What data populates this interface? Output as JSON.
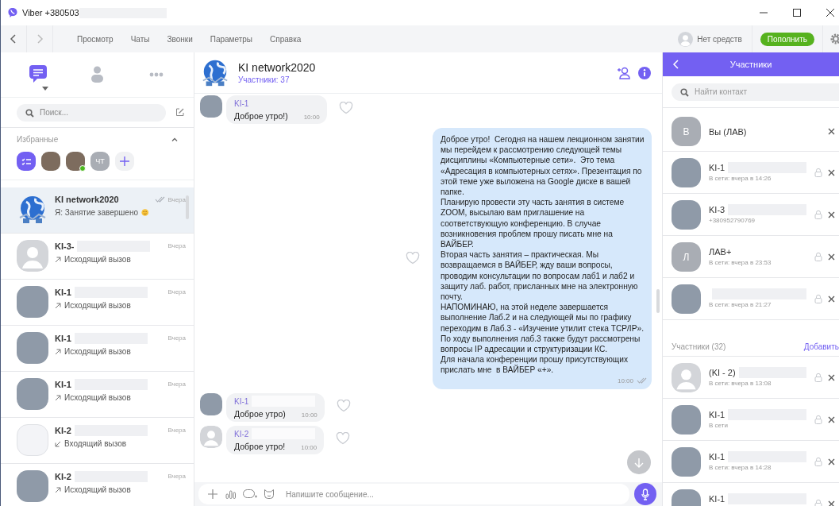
{
  "window": {
    "title": "Viber +380503",
    "title_redacted": true
  },
  "menu": {
    "items": [
      "Просмотр",
      "Чаты",
      "Звонки",
      "Параметры",
      "Справка"
    ],
    "balance": "Нет средств",
    "topup_button": "Пополнить"
  },
  "sidebar": {
    "tabs": [
      {
        "kind": "chats",
        "selected": true
      },
      {
        "kind": "contacts",
        "selected": false
      },
      {
        "kind": "more",
        "selected": false
      }
    ],
    "search": {
      "placeholder": "Поиск..."
    },
    "favorites": {
      "title": "Избранные",
      "expanded": true,
      "items": [
        {
          "kind": "list",
          "online": false
        },
        {
          "kind": "photo",
          "online": false
        },
        {
          "kind": "photo",
          "online": true
        },
        {
          "kind": "letter",
          "text": "ЧТ",
          "online": false
        },
        {
          "kind": "add",
          "online": false
        }
      ]
    },
    "chats": [
      {
        "avatar": {
          "kind": "globe"
        },
        "name": "KI network2020",
        "redacted": false,
        "time": "Вчера",
        "read": true,
        "emoji": true,
        "preview": "Я: Занятие завершено",
        "selected": true
      },
      {
        "avatar": {
          "kind": "default"
        },
        "name": "KI-3-",
        "redacted": true,
        "time": "Вчера",
        "read": false,
        "call": {
          "kind": "outgoing"
        },
        "emoji": false,
        "preview": "Исходящий вызов",
        "selected": false
      },
      {
        "avatar": {
          "kind": "photo"
        },
        "name": "KI-1",
        "redacted": true,
        "time": "Вчера",
        "read": false,
        "call": {
          "kind": "outgoing"
        },
        "emoji": false,
        "preview": "Исходящий вызов",
        "selected": false
      },
      {
        "avatar": {
          "kind": "photo"
        },
        "name": "KI-1",
        "redacted": true,
        "time": "Вчера",
        "read": false,
        "call": {
          "kind": "outgoing"
        },
        "emoji": false,
        "preview": "Исходящий вызов",
        "selected": false
      },
      {
        "avatar": {
          "kind": "photo"
        },
        "name": "KI-1",
        "redacted": true,
        "time": "Вчера",
        "read": false,
        "call": {
          "kind": "outgoing"
        },
        "emoji": false,
        "preview": "Исходящий вызов",
        "selected": false
      },
      {
        "avatar": {
          "kind": "document"
        },
        "name": "KI-2",
        "redacted": true,
        "time": "Вчера",
        "read": false,
        "call": {
          "kind": "incoming"
        },
        "emoji": false,
        "preview": "Входящий вызов",
        "selected": false
      },
      {
        "avatar": {
          "kind": "photo"
        },
        "name": "KI-2",
        "redacted": true,
        "time": "Вчера",
        "read": false,
        "call": {
          "kind": "outgoing"
        },
        "emoji": false,
        "preview": "Исходящий вызов",
        "selected": false
      }
    ]
  },
  "chat": {
    "title": "KI network2020",
    "subtitle": "Участники: 37",
    "messages": [
      {
        "kind": "in",
        "avatar": {
          "kind": "photo"
        },
        "sender": "KI-1",
        "redacted": false,
        "text": "Доброе утро!)",
        "time": "10:00",
        "read": false
      },
      {
        "kind": "out",
        "text": "Доброе утро!  Сегодня на нашем лекционном занятии мы перейдем к рассмотрению следующей темы дисциплины «Компьютерные сети».  Это тема «Адресация в компьютерных сетях». Презентация по этой теме уже выложена на Google диске в вашей папке.\nПланирую провести эту часть занятия в системе ZOOM, высылаю вам приглашение на соответствующую конференцию. В случае возникновения проблем прошу писать мне на ВАЙБЕР.\nВторая часть занятия – практическая. Мы возвращаемся в ВАЙБЕР, жду ваши вопросы, проводим консультации по вопросам лаб1 и лаб2 и защиту лаб. работ, присланных мне на электронную почту.\nНАПОМИНАЮ, на этой неделе завершается выполнение Лаб.2 и на следующей мы по графику переходим в Лаб.3 - «Изучение утилит стека TCP/IP». По ходу выполнения лаб.3 также будут рассмотрены вопросы IP адресации и структуризации КС.\nДля начала конференции прошу присутствующих прислать мне  в ВАЙБЕР «+».",
        "time": "10:00",
        "read": true
      },
      {
        "kind": "in",
        "avatar": {
          "kind": "photo"
        },
        "sender": "KI-1",
        "redacted": true,
        "text": "Доброе утро)",
        "time": "10:00",
        "read": false
      },
      {
        "kind": "in",
        "avatar": {
          "kind": "default"
        },
        "sender": "KI-2",
        "redacted": true,
        "text": "Доброе утро!",
        "time": "10:00",
        "read": false
      }
    ],
    "input": {
      "placeholder": "Напишите сообщение..."
    }
  },
  "members_panel": {
    "title": "Участники",
    "search": {
      "placeholder": "Найти контакт"
    },
    "admins": [
      {
        "avatar": {
          "kind": "letter",
          "text": "В"
        },
        "name": "Вы (ЛАВ)",
        "redacted": false,
        "lock": false
      },
      {
        "avatar": {
          "kind": "photo"
        },
        "name": "KI-1",
        "redacted": true,
        "status": "В сети: вчера в 14:26",
        "lock": true
      },
      {
        "avatar": {
          "kind": "photo"
        },
        "name": "KI-3",
        "redacted": true,
        "status": "+380952790769",
        "lock": true
      },
      {
        "avatar": {
          "kind": "letter",
          "text": "Л"
        },
        "name": "ЛАВ+",
        "redacted": false,
        "status": "В сети: вчера в 23:53",
        "lock": true
      },
      {
        "avatar": {
          "kind": "photo"
        },
        "redacted": true,
        "status": "В сети: вчера в 21:27",
        "lock": true
      }
    ],
    "section_title": "Участники (32)",
    "add_link": "Добавить",
    "members": [
      {
        "avatar": {
          "kind": "default"
        },
        "name": "(KI - 2)",
        "redacted": true,
        "status": "В сети: вчера в 13:08",
        "lock": true
      },
      {
        "avatar": {
          "kind": "photo"
        },
        "name": "KI-1",
        "redacted": true,
        "status": "В сети",
        "lock": true
      },
      {
        "avatar": {
          "kind": "photo"
        },
        "name": "KI-1",
        "redacted": true,
        "status": "В сети: вчера в 14:28",
        "lock": true
      },
      {
        "avatar": {
          "kind": "photo"
        },
        "name": "KI-1",
        "redacted": true,
        "lock": true
      }
    ]
  }
}
